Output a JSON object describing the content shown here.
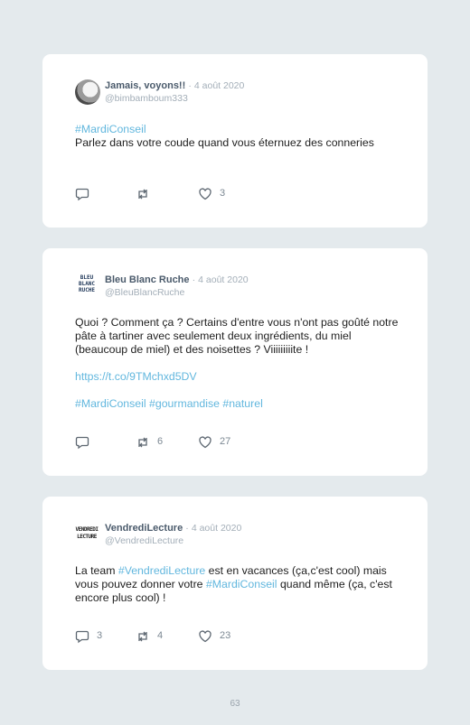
{
  "tweets": [
    {
      "name": "Jamais, voyons!!",
      "separator": "·",
      "date": "4 août 2020",
      "handle": "@bimbamboum333",
      "line1_tag": "#MardiConseil",
      "line2": "Parlez dans votre coude quand vous éternuez des conneries",
      "retweets": "",
      "likes": "3"
    },
    {
      "name": "Bleu Blanc Ruche",
      "separator": "·",
      "date": "4 août 2020",
      "handle": "@BleuBlancRuche",
      "logo_text": "BLEU BLANC RUCHE",
      "text": "Quoi ? Comment ça ? Certains d'entre vous n'ont pas goûté notre pâte à tartiner avec seulement deux ingrédients, du miel (beaucoup de miel) et des noisettes ? Viiiiiiiiite !",
      "link": "https://t.co/9TMchxd5DV",
      "tags": "#MardiConseil #gourmandise #naturel",
      "retweets": "6",
      "likes": "27"
    },
    {
      "name": "VendrediLecture",
      "separator": "·",
      "date": "4 août 2020",
      "handle": "@VendrediLecture",
      "logo_text": "VENDREDI LECTURE",
      "text_a": "La team ",
      "tag_a": "#VendrediLecture",
      "text_b": " est en vacances (ça,c'est cool) mais vous pouvez donner votre ",
      "tag_b": "#MardiConseil",
      "text_c": " quand même (ça, c'est encore plus cool) !",
      "replies": "3",
      "retweets": "4",
      "likes": "23"
    }
  ],
  "page_number": "63",
  "colors": {
    "background": "#e4eaed",
    "accent": "#62b7de",
    "card": "#ffffff"
  }
}
